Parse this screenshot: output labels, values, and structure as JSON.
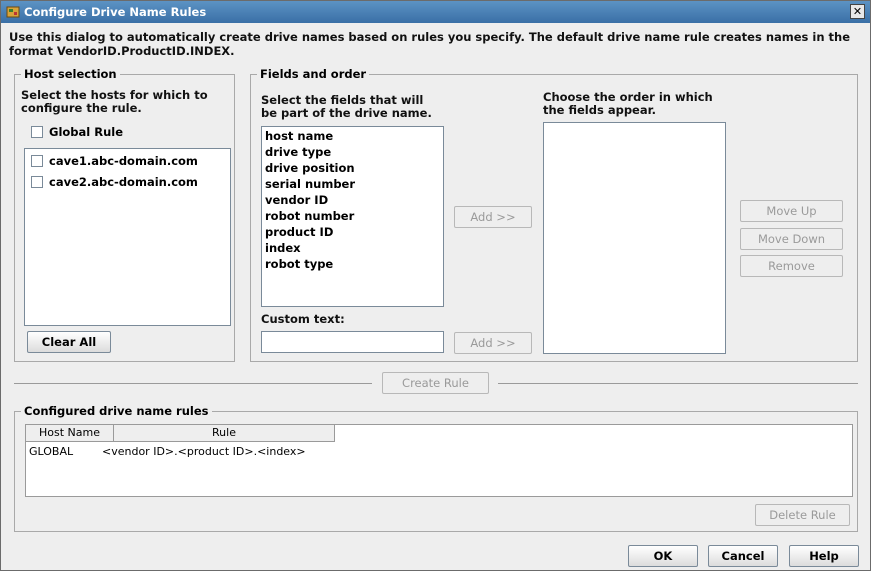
{
  "window": {
    "title": "Configure Drive Name Rules",
    "close_symbol": "✕"
  },
  "intro": "Use this dialog to automatically create drive names based on rules you specify. The default drive name rule creates names in the format VendorID.ProductID.INDEX.",
  "host_selection": {
    "legend": "Host selection",
    "instructions": "Select the hosts for which to configure the rule.",
    "global_rule_label": "Global Rule",
    "hosts": [
      "cave1.abc-domain.com",
      "cave2.abc-domain.com"
    ],
    "clear_all_label": "Clear All"
  },
  "fields_and_order": {
    "legend": "Fields and order",
    "select_fields_label": "Select the fields that will be part of the drive name.",
    "fields": [
      "host name",
      "drive type",
      "drive position",
      "serial number",
      "vendor ID",
      "robot number",
      "product ID",
      "index",
      "robot type"
    ],
    "add_label": "Add >>",
    "custom_text_label": "Custom text:",
    "custom_text_value": "",
    "add_custom_label": "Add >>",
    "order_label": "Choose the order in which the fields appear.",
    "move_up_label": "Move Up",
    "move_down_label": "Move Down",
    "remove_label": "Remove"
  },
  "create_rule_label": "Create Rule",
  "configured_rules": {
    "legend": "Configured drive name rules",
    "columns": [
      "Host Name",
      "Rule"
    ],
    "rows": [
      {
        "host": "GLOBAL",
        "rule": "<vendor ID>.<product ID>.<index>"
      }
    ],
    "delete_rule_label": "Delete Rule"
  },
  "footer": {
    "ok_label": "OK",
    "cancel_label": "Cancel",
    "help_label": "Help"
  },
  "colors": {
    "titlebar": "#3a6fa6",
    "window_bg": "#eeeeee",
    "disabled_text": "#9a9a9a"
  },
  "icons": [
    "app-icon",
    "close-icon"
  ]
}
